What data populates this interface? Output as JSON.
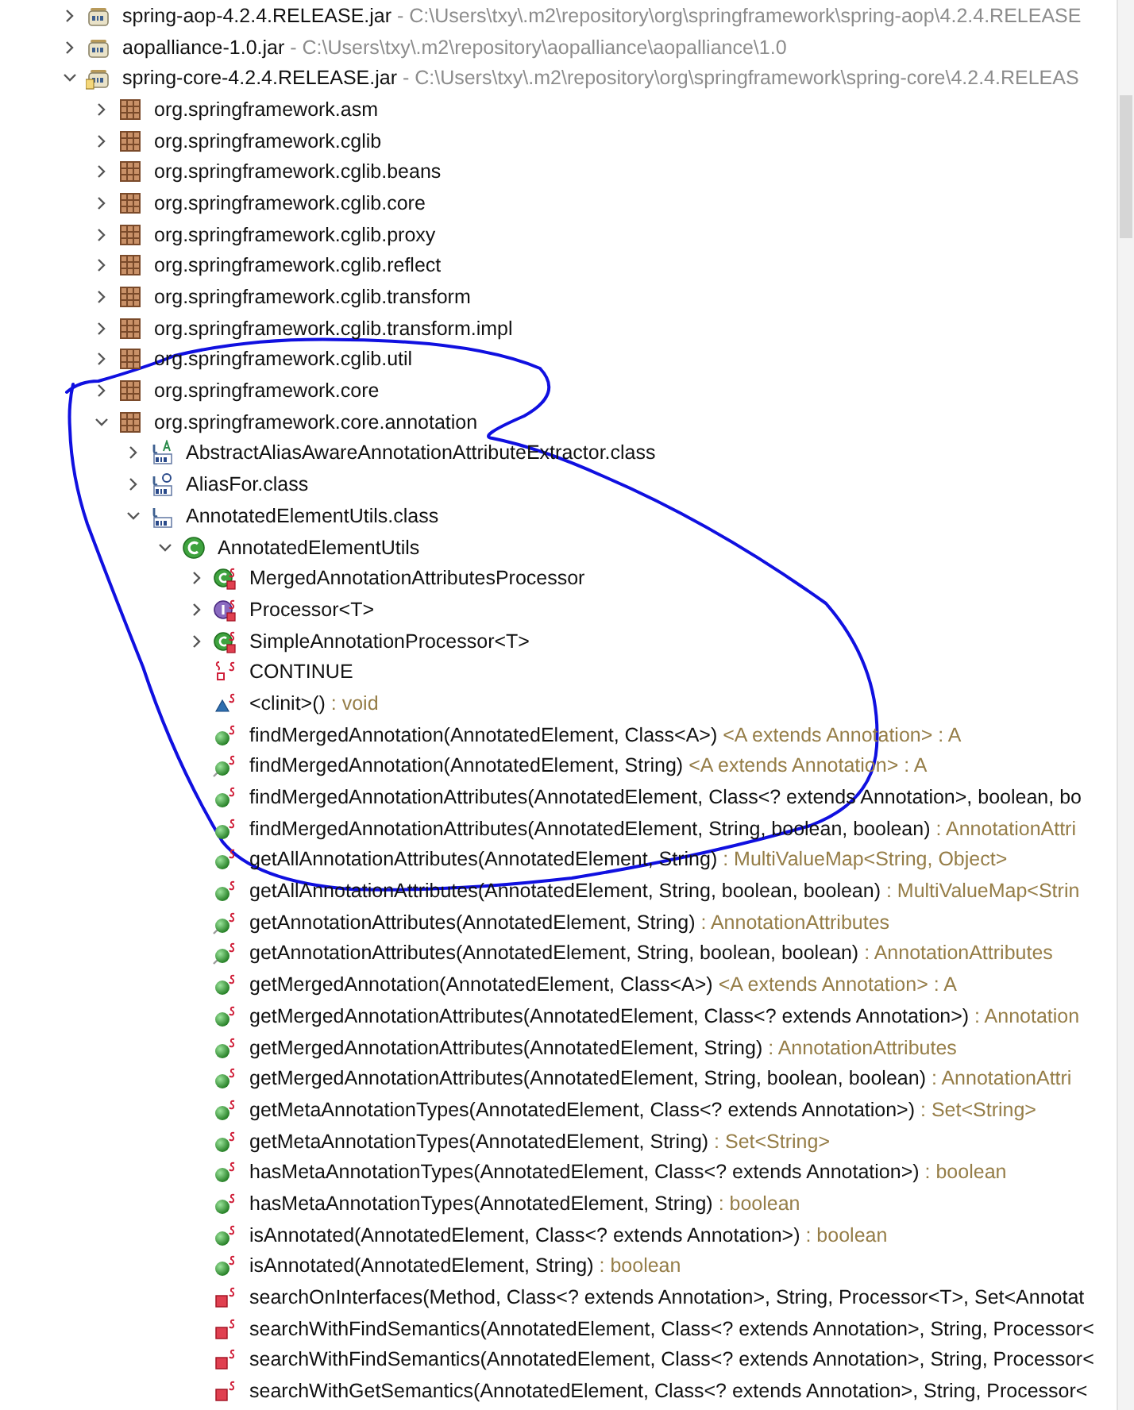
{
  "tree": [
    {
      "kind": "jar",
      "label": "spring-aop-4.2.4.RELEASE.jar",
      "detail": "- C:\\Users\\txy\\.m2\\repository\\org\\springframework\\spring-aop\\4.2.4.RELEASE",
      "expanded": false
    },
    {
      "kind": "jar",
      "label": "aopalliance-1.0.jar",
      "detail": "- C:\\Users\\txy\\.m2\\repository\\aopalliance\\aopalliance\\1.0",
      "expanded": false
    },
    {
      "kind": "jar_source",
      "label": "spring-core-4.2.4.RELEASE.jar",
      "detail": "- C:\\Users\\txy\\.m2\\repository\\org\\springframework\\spring-core\\4.2.4.RELEAS",
      "expanded": true,
      "children": [
        {
          "kind": "package",
          "label": "org.springframework.asm",
          "expanded": false
        },
        {
          "kind": "package",
          "label": "org.springframework.cglib",
          "expanded": false
        },
        {
          "kind": "package",
          "label": "org.springframework.cglib.beans",
          "expanded": false
        },
        {
          "kind": "package",
          "label": "org.springframework.cglib.core",
          "expanded": false
        },
        {
          "kind": "package",
          "label": "org.springframework.cglib.proxy",
          "expanded": false
        },
        {
          "kind": "package",
          "label": "org.springframework.cglib.reflect",
          "expanded": false
        },
        {
          "kind": "package",
          "label": "org.springframework.cglib.transform",
          "expanded": false
        },
        {
          "kind": "package",
          "label": "org.springframework.cglib.transform.impl",
          "expanded": false
        },
        {
          "kind": "package",
          "label": "org.springframework.cglib.util",
          "expanded": false
        },
        {
          "kind": "package",
          "label": "org.springframework.core",
          "expanded": false
        },
        {
          "kind": "package",
          "label": "org.springframework.core.annotation",
          "expanded": true,
          "children": [
            {
              "kind": "class_file_abstract",
              "label": "AbstractAliasAwareAnnotationAttributeExtractor.class",
              "expanded": false
            },
            {
              "kind": "class_file_annotation",
              "label": "AliasFor.class",
              "expanded": false
            },
            {
              "kind": "class_file",
              "label": "AnnotatedElementUtils.class",
              "expanded": true,
              "children": [
                {
                  "kind": "class",
                  "label": "AnnotatedElementUtils",
                  "expanded": true,
                  "children": [
                    {
                      "kind": "inner_class",
                      "label": "MergedAnnotationAttributesProcessor",
                      "expanded": false
                    },
                    {
                      "kind": "interface",
                      "label": "Processor<T>",
                      "expanded": false
                    },
                    {
                      "kind": "inner_class_abstract",
                      "label": "SimpleAnnotationProcessor<T>",
                      "expanded": false
                    },
                    {
                      "kind": "field",
                      "label": "CONTINUE"
                    },
                    {
                      "kind": "static_init",
                      "label": "<clinit>()",
                      "detail": ": void"
                    },
                    {
                      "kind": "method_public",
                      "label": "findMergedAnnotation(AnnotatedElement, Class<A>)",
                      "detail": "<A extends Annotation> : A"
                    },
                    {
                      "kind": "method_tagged",
                      "label": "findMergedAnnotation(AnnotatedElement, String)",
                      "detail": "<A extends Annotation> : A"
                    },
                    {
                      "kind": "method_public",
                      "label": "findMergedAnnotationAttributes(AnnotatedElement, Class<? extends Annotation>, boolean, bo"
                    },
                    {
                      "kind": "method_public",
                      "label": "findMergedAnnotationAttributes(AnnotatedElement, String, boolean, boolean)",
                      "detail": ": AnnotationAttri"
                    },
                    {
                      "kind": "method_public",
                      "label": "getAllAnnotationAttributes(AnnotatedElement, String)",
                      "detail": ": MultiValueMap<String, Object>"
                    },
                    {
                      "kind": "method_public",
                      "label": "getAllAnnotationAttributes(AnnotatedElement, String, boolean, boolean)",
                      "detail": ": MultiValueMap<Strin"
                    },
                    {
                      "kind": "method_tagged",
                      "label": "getAnnotationAttributes(AnnotatedElement, String)",
                      "detail": ": AnnotationAttributes"
                    },
                    {
                      "kind": "method_tagged",
                      "label": "getAnnotationAttributes(AnnotatedElement, String, boolean, boolean)",
                      "detail": ": AnnotationAttributes"
                    },
                    {
                      "kind": "method_public",
                      "label": "getMergedAnnotation(AnnotatedElement, Class<A>)",
                      "detail": "<A extends Annotation> : A"
                    },
                    {
                      "kind": "method_public",
                      "label": "getMergedAnnotationAttributes(AnnotatedElement, Class<? extends Annotation>)",
                      "detail": ": Annotation"
                    },
                    {
                      "kind": "method_public",
                      "label": "getMergedAnnotationAttributes(AnnotatedElement, String)",
                      "detail": ": AnnotationAttributes"
                    },
                    {
                      "kind": "method_public",
                      "label": "getMergedAnnotationAttributes(AnnotatedElement, String, boolean, boolean)",
                      "detail": ": AnnotationAttri"
                    },
                    {
                      "kind": "method_public",
                      "label": "getMetaAnnotationTypes(AnnotatedElement, Class<? extends Annotation>)",
                      "detail": ": Set<String>"
                    },
                    {
                      "kind": "method_public",
                      "label": "getMetaAnnotationTypes(AnnotatedElement, String)",
                      "detail": ": Set<String>"
                    },
                    {
                      "kind": "method_public",
                      "label": "hasMetaAnnotationTypes(AnnotatedElement, Class<? extends Annotation>)",
                      "detail": ": boolean"
                    },
                    {
                      "kind": "method_public",
                      "label": "hasMetaAnnotationTypes(AnnotatedElement, String)",
                      "detail": ": boolean"
                    },
                    {
                      "kind": "method_public",
                      "label": "isAnnotated(AnnotatedElement, Class<? extends Annotation>)",
                      "detail": ": boolean"
                    },
                    {
                      "kind": "method_public",
                      "label": "isAnnotated(AnnotatedElement, String)",
                      "detail": ": boolean"
                    },
                    {
                      "kind": "method_private",
                      "label": "searchOnInterfaces(Method, Class<? extends Annotation>, String, Processor<T>, Set<Annotat"
                    },
                    {
                      "kind": "method_private",
                      "label": "searchWithFindSemantics(AnnotatedElement, Class<? extends Annotation>, String, Processor<"
                    },
                    {
                      "kind": "method_private",
                      "label": "searchWithFindSemantics(AnnotatedElement, Class<? extends Annotation>, String, Processor<"
                    },
                    {
                      "kind": "method_private",
                      "label": "searchWithGetSemantics(AnnotatedElement, Class<? extends Annotation>, String, Processor<"
                    }
                  ]
                }
              ]
            }
          ]
        }
      ]
    }
  ]
}
